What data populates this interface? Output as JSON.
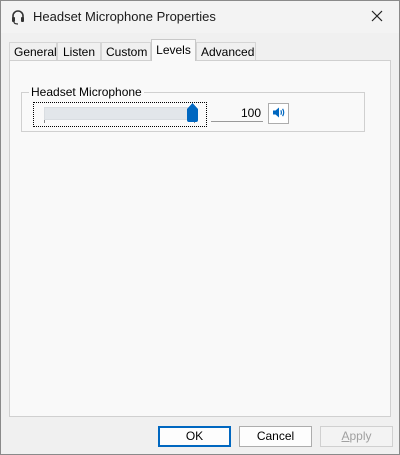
{
  "window": {
    "title": "Headset Microphone Properties"
  },
  "tabs": [
    {
      "label": "General"
    },
    {
      "label": "Listen"
    },
    {
      "label": "Custom"
    },
    {
      "label": "Levels",
      "active": true
    },
    {
      "label": "Advanced"
    }
  ],
  "levels": {
    "group_label": "Headset Microphone",
    "slider_value": 100,
    "slider_max": 100,
    "value_text": "100",
    "muted": false
  },
  "buttons": {
    "ok": "OK",
    "cancel": "Cancel",
    "apply_first": "A",
    "apply_rest": "pply"
  },
  "icons": {
    "title": "headset-icon",
    "close": "close-icon",
    "speaker": "speaker-icon"
  },
  "colors": {
    "accent": "#0067c0",
    "window_bg": "#f0f0f0",
    "panel_bg": "#f9f9f9"
  }
}
